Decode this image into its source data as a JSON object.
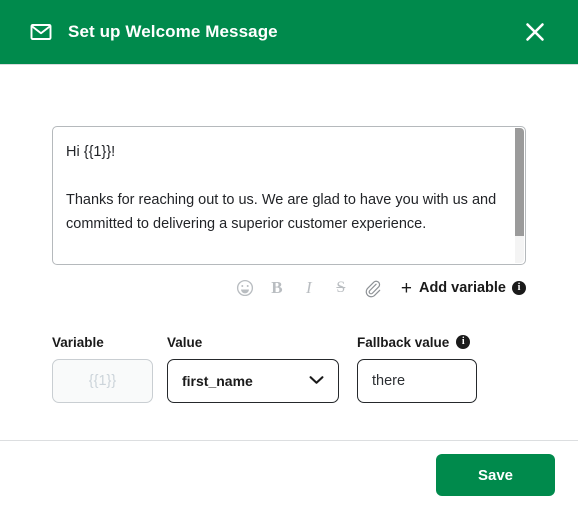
{
  "header": {
    "title": "Set up Welcome Message",
    "envelope_icon": "envelope-icon",
    "close_icon": "close-icon",
    "background_color": "#008a4c"
  },
  "composer": {
    "message": "Hi {{1}}!\n\nThanks for reaching out to us. We are glad to have you with us and committed to delivering a superior customer experience.",
    "has_scrollbar": true
  },
  "toolbar": {
    "emoji_icon": "emoji-icon",
    "bold_label": "B",
    "italic_label": "I",
    "strikethrough_label": "S",
    "attachment_icon": "paperclip-icon",
    "plus_label": "+",
    "add_variable_label": "Add variable",
    "info_label": "i"
  },
  "variable_row": {
    "variable": {
      "label": "Variable",
      "value": "{{1}}"
    },
    "value": {
      "label": "Value",
      "selected": "first_name",
      "options": [
        "first_name"
      ],
      "chevron_icon": "chevron-down-icon"
    },
    "fallback": {
      "label": "Fallback value",
      "info_label": "i",
      "value": "there"
    }
  },
  "footer": {
    "save_label": "Save",
    "save_color": "#008a4c"
  }
}
